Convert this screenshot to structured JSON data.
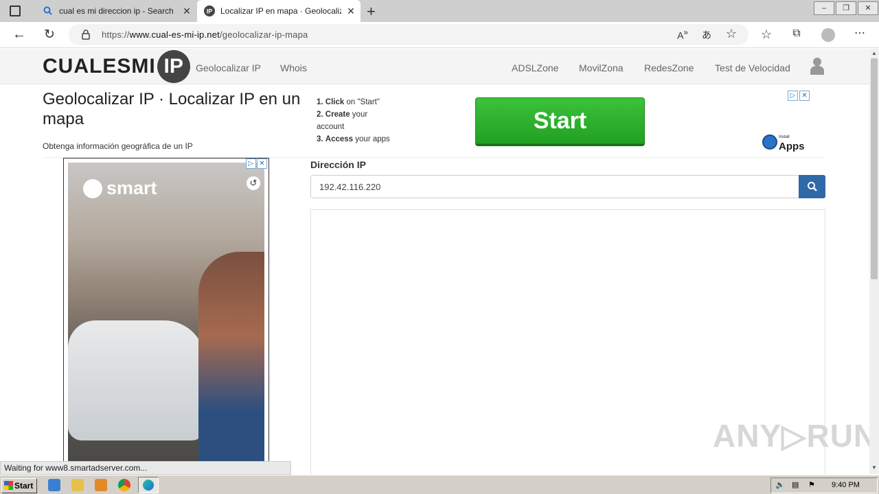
{
  "browser": {
    "tabs": [
      {
        "title": "cual es mi direccion ip - Search",
        "active": false
      },
      {
        "title": "Localizar IP en mapa · Geolocaliz",
        "active": true
      }
    ],
    "url_prefix": "https://",
    "url_host": "www.cual-es-mi-ip.net",
    "url_path": "/geolocalizar-ip-mapa",
    "status_text": "Waiting for www8.smartadserver.com..."
  },
  "site": {
    "logo_text": "CUALESMI",
    "logo_circle": "IP",
    "nav_left": [
      "Geolocalizar IP",
      "Whois"
    ],
    "nav_right": [
      "ADSLZone",
      "MovilZona",
      "RedesZone",
      "Test de Velocidad"
    ]
  },
  "page": {
    "title": "Geolocalizar IP · Localizar IP en un mapa",
    "subtitle": "Obtenga información geográfica de un IP"
  },
  "top_ad": {
    "steps": [
      {
        "num": "1.",
        "bold": "Click",
        "rest": " on \"Start\""
      },
      {
        "num": "2.",
        "bold": "Create",
        "rest": " your account"
      },
      {
        "num": "3.",
        "bold": "Access",
        "rest": " your apps"
      }
    ],
    "button_label": "Start",
    "badge_small": "Install",
    "badge_text": "Apps"
  },
  "side_ad": {
    "brand": "smart"
  },
  "form": {
    "label": "Dirección IP",
    "ip_value": "192.42.116.220"
  },
  "watermark": "ANY▷RUN",
  "taskbar": {
    "start_label": "Start",
    "clock": "9:40 PM"
  },
  "colors": {
    "start_green": "#27a827",
    "search_blue": "#2f69a8"
  }
}
